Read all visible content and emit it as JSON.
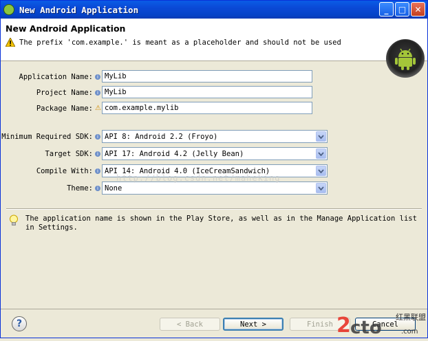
{
  "window": {
    "title": "New Android Application"
  },
  "titlebar_buttons": {
    "minimize": "_",
    "maximize": "□",
    "close": "✕"
  },
  "header": {
    "title": "New Android Application",
    "warning": "The prefix 'com.example.' is meant as a placeholder and should not be used"
  },
  "fields": {
    "application_name": {
      "label": "Application Name:",
      "value": "MyLib"
    },
    "project_name": {
      "label": "Project Name:",
      "value": "MyLib"
    },
    "package_name": {
      "label": "Package Name:",
      "value": "com.example.mylib"
    }
  },
  "selects": {
    "min_sdk": {
      "label": "Minimum Required SDK:",
      "value": "API 8: Android 2.2 (Froyo)"
    },
    "target_sdk": {
      "label": "Target SDK:",
      "value": "API 17: Android 4.2 (Jelly Bean)"
    },
    "compile_with": {
      "label": "Compile With:",
      "value": "API 14: Android 4.0 (IceCreamSandwich)"
    },
    "theme": {
      "label": "Theme:",
      "value": "None"
    }
  },
  "tip": "The application name is shown in the Play Store, as well as in the Manage Application list in Settings.",
  "watermark": "http://blog.csdn.net/maheking",
  "buttons": {
    "back": "< Back",
    "next": "Next >",
    "finish": "Finish",
    "cancel": "Cancel"
  },
  "help": "?",
  "corner_logo": {
    "text": "2cto",
    "subtext": "红黑联盟",
    "sub2": ".com"
  },
  "colors": {
    "title_bar": "#0a49d6",
    "android_green": "#a4c639",
    "window_bg": "#ece9d8"
  }
}
